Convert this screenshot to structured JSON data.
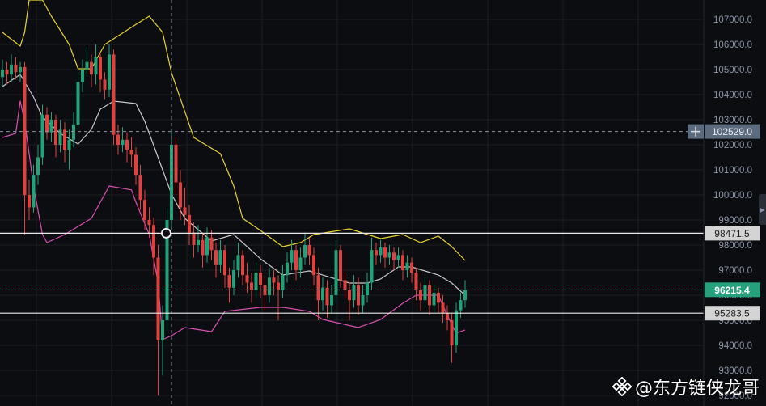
{
  "chart_data": {
    "type": "candlestick",
    "title": "",
    "ylim": [
      92000,
      107000
    ],
    "yticks": [
      "107000.0",
      "106000.0",
      "105000.0",
      "104000.0",
      "103000.0",
      "102000.0",
      "101000.0",
      "100000.0",
      "99000.0",
      "98000.0",
      "97000.0",
      "96000.0",
      "95000.0",
      "94000.0",
      "93000.0",
      "92000.0"
    ],
    "ytick_values": [
      107000,
      106000,
      105000,
      104000,
      103000,
      102000,
      101000,
      100000,
      99000,
      98000,
      97000,
      96000,
      95000,
      94000,
      93000,
      92000
    ],
    "grid": true,
    "colors": {
      "up": "#1fa47a",
      "down": "#e0413f",
      "upper_band": "#e6d12a",
      "middle_band": "#c8c8c8",
      "lower_band": "#d94fb0",
      "last_price": "#26a17b",
      "crosshair_tag": "#5d6b7e"
    },
    "ohlc": [
      [
        104700,
        105400,
        104300,
        105000
      ],
      [
        105000,
        105300,
        104400,
        104800
      ],
      [
        104800,
        105600,
        104500,
        105200
      ],
      [
        105200,
        105500,
        104600,
        104900
      ],
      [
        104900,
        105300,
        104500,
        105100
      ],
      [
        105100,
        105300,
        98400,
        100000
      ],
      [
        100000,
        100600,
        99000,
        99500
      ],
      [
        99500,
        101200,
        99300,
        100800
      ],
      [
        100800,
        102000,
        100400,
        101500
      ],
      [
        101500,
        103600,
        101200,
        103200
      ],
      [
        103200,
        103500,
        102200,
        102500
      ],
      [
        102500,
        103300,
        102100,
        103000
      ],
      [
        103000,
        103200,
        101500,
        102000
      ],
      [
        102000,
        103000,
        101700,
        102600
      ],
      [
        102600,
        102900,
        101300,
        101800
      ],
      [
        101800,
        102600,
        101000,
        102200
      ],
      [
        102200,
        103300,
        101900,
        102800
      ],
      [
        102800,
        104900,
        102600,
        104500
      ],
      [
        104500,
        105400,
        104100,
        105000
      ],
      [
        105000,
        105900,
        104700,
        105300
      ],
      [
        105300,
        105600,
        104300,
        104800
      ],
      [
        104800,
        106000,
        104400,
        105500
      ],
      [
        105500,
        105700,
        104100,
        104600
      ],
      [
        104600,
        104900,
        103800,
        104200
      ],
      [
        104200,
        106000,
        103900,
        105600
      ],
      [
        105600,
        105800,
        102000,
        102400
      ],
      [
        102400,
        102800,
        101600,
        102000
      ],
      [
        102000,
        102700,
        101700,
        102200
      ],
      [
        102200,
        102500,
        101300,
        101800
      ],
      [
        101800,
        102300,
        101100,
        101600
      ],
      [
        101600,
        101900,
        100400,
        100800
      ],
      [
        100800,
        101200,
        99400,
        99800
      ],
      [
        99800,
        100200,
        98600,
        99000
      ],
      [
        99000,
        99500,
        98300,
        98800
      ],
      [
        98800,
        99100,
        96800,
        97500
      ],
      [
        97500,
        98000,
        92000,
        94200
      ],
      [
        94200,
        95600,
        92800,
        95000
      ],
      [
        95000,
        99500,
        94600,
        99000
      ],
      [
        99000,
        102500,
        98700,
        102000
      ],
      [
        102000,
        102300,
        100000,
        100500
      ],
      [
        100500,
        101000,
        99000,
        99500
      ],
      [
        99500,
        100300,
        98800,
        99200
      ],
      [
        99200,
        99600,
        98000,
        98500
      ],
      [
        98500,
        98900,
        97500,
        98000
      ],
      [
        98000,
        98800,
        97700,
        98200
      ],
      [
        98200,
        98500,
        97100,
        97600
      ],
      [
        97600,
        98700,
        97300,
        98300
      ],
      [
        98300,
        98600,
        97400,
        97800
      ],
      [
        97800,
        98100,
        96700,
        97200
      ],
      [
        97200,
        98200,
        96900,
        97800
      ],
      [
        97800,
        98000,
        96300,
        96800
      ],
      [
        96800,
        97100,
        95700,
        96300
      ],
      [
        96300,
        97400,
        96000,
        97000
      ],
      [
        97000,
        98100,
        96700,
        97600
      ],
      [
        97600,
        97800,
        96400,
        96800
      ],
      [
        96800,
        97300,
        96100,
        96500
      ],
      [
        96500,
        96900,
        95700,
        96200
      ],
      [
        96200,
        97300,
        95900,
        96900
      ],
      [
        96900,
        97200,
        95900,
        96400
      ],
      [
        96400,
        96700,
        95400,
        96000
      ],
      [
        96000,
        97100,
        95700,
        96700
      ],
      [
        96700,
        97000,
        96000,
        96500
      ],
      [
        96500,
        96800,
        95000,
        96200
      ],
      [
        96200,
        97200,
        95900,
        96800
      ],
      [
        96800,
        97700,
        96500,
        97300
      ],
      [
        97300,
        98200,
        97000,
        97800
      ],
      [
        97800,
        98000,
        96600,
        97000
      ],
      [
        97000,
        97900,
        96700,
        97500
      ],
      [
        97500,
        98500,
        97200,
        98000
      ],
      [
        98000,
        98300,
        97200,
        97600
      ],
      [
        97600,
        97900,
        96400,
        96800
      ],
      [
        96800,
        97100,
        95000,
        95800
      ],
      [
        95800,
        96700,
        95400,
        96300
      ],
      [
        96300,
        96600,
        95100,
        95600
      ],
      [
        95600,
        96400,
        95300,
        96000
      ],
      [
        96000,
        98200,
        95700,
        97800
      ],
      [
        97800,
        98000,
        96300,
        96600
      ],
      [
        96600,
        96900,
        95900,
        96200
      ],
      [
        96200,
        96500,
        95000,
        95800
      ],
      [
        95800,
        96800,
        95500,
        96400
      ],
      [
        96400,
        96700,
        95200,
        95600
      ],
      [
        95600,
        96400,
        95300,
        96000
      ],
      [
        96000,
        96900,
        95700,
        96500
      ],
      [
        96500,
        98300,
        96200,
        97800
      ],
      [
        97800,
        98100,
        97200,
        97600
      ],
      [
        97600,
        98200,
        97300,
        97900
      ],
      [
        97900,
        98100,
        97100,
        97500
      ],
      [
        97500,
        98000,
        97200,
        97700
      ],
      [
        97700,
        97900,
        97000,
        97400
      ],
      [
        97400,
        97900,
        97100,
        97600
      ],
      [
        97600,
        97800,
        96600,
        97000
      ],
      [
        97000,
        97600,
        96700,
        97300
      ],
      [
        97300,
        97500,
        96500,
        96900
      ],
      [
        96900,
        97100,
        95800,
        96200
      ],
      [
        96200,
        96500,
        95400,
        95800
      ],
      [
        95800,
        96700,
        95500,
        96400
      ],
      [
        96400,
        96600,
        95200,
        95600
      ],
      [
        95600,
        96400,
        95300,
        96100
      ],
      [
        96100,
        96300,
        95300,
        95700
      ],
      [
        95700,
        96000,
        94900,
        95300
      ],
      [
        95300,
        95600,
        94600,
        95000
      ],
      [
        95000,
        95300,
        93300,
        94000
      ],
      [
        94000,
        95700,
        93700,
        95400
      ],
      [
        95400,
        96100,
        95100,
        95800
      ],
      [
        95800,
        96600,
        95500,
        96215.4
      ]
    ],
    "bands": {
      "upper": [
        [
          0,
          106484
        ],
        [
          4,
          105935
        ],
        [
          5,
          106484
        ],
        [
          6,
          107774
        ],
        [
          9,
          107774
        ],
        [
          11,
          107129
        ],
        [
          15,
          106000
        ],
        [
          17,
          105032
        ],
        [
          20,
          105032
        ],
        [
          23,
          106000
        ],
        [
          30,
          106800
        ],
        [
          33,
          107129
        ],
        [
          36,
          106484
        ],
        [
          38,
          104871
        ],
        [
          43,
          102290
        ],
        [
          49,
          101645
        ],
        [
          52,
          100355
        ],
        [
          54,
          99064
        ],
        [
          58,
          98581
        ],
        [
          63,
          97935
        ],
        [
          67,
          98097
        ],
        [
          70,
          98419
        ],
        [
          78,
          98645
        ],
        [
          85,
          98258
        ],
        [
          90,
          98419
        ],
        [
          94,
          98097
        ],
        [
          98,
          98355
        ],
        [
          101,
          97935
        ],
        [
          104,
          97387
        ]
      ],
      "middle": [
        [
          0,
          104323
        ],
        [
          4,
          104806
        ],
        [
          7,
          103903
        ],
        [
          9,
          103097
        ],
        [
          13,
          102452
        ],
        [
          17,
          102032
        ],
        [
          20,
          102613
        ],
        [
          22,
          103419
        ],
        [
          25,
          103742
        ],
        [
          30,
          103645
        ],
        [
          32,
          102935
        ],
        [
          35,
          101484
        ],
        [
          38,
          100032
        ],
        [
          41,
          99064
        ],
        [
          47,
          98161
        ],
        [
          52,
          98419
        ],
        [
          58,
          97452
        ],
        [
          63,
          96806
        ],
        [
          69,
          96968
        ],
        [
          72,
          96806
        ],
        [
          78,
          96484
        ],
        [
          82,
          96484
        ],
        [
          85,
          96645
        ],
        [
          89,
          97129
        ],
        [
          92,
          97129
        ],
        [
          98,
          96806
        ],
        [
          101,
          96484
        ],
        [
          104,
          96000
        ]
      ],
      "lower": [
        [
          0,
          102290
        ],
        [
          3,
          102452
        ],
        [
          4,
          103742
        ],
        [
          5,
          102935
        ],
        [
          7,
          100355
        ],
        [
          9,
          98419
        ],
        [
          10,
          98097
        ],
        [
          14,
          98419
        ],
        [
          17,
          98742
        ],
        [
          20,
          99064
        ],
        [
          24,
          100355
        ],
        [
          29,
          100200
        ],
        [
          30,
          99710
        ],
        [
          33,
          98419
        ],
        [
          35,
          96484
        ],
        [
          36,
          94226
        ],
        [
          38,
          94387
        ],
        [
          41,
          94710
        ],
        [
          47,
          94548
        ],
        [
          50,
          95355
        ],
        [
          58,
          95516
        ],
        [
          63,
          95516
        ],
        [
          69,
          95355
        ],
        [
          72,
          95032
        ],
        [
          80,
          94710
        ],
        [
          85,
          95032
        ],
        [
          90,
          95677
        ],
        [
          93,
          96000
        ],
        [
          98,
          96000
        ],
        [
          100,
          95194
        ],
        [
          102,
          94484
        ],
        [
          104,
          94613
        ]
      ]
    },
    "price_lines": {
      "crosshair_price": "102529.0",
      "crosshair_value": 102529.0,
      "resistance": "98471.5",
      "resistance_value": 98471.5,
      "last_price": "96215.4",
      "last_value": 96215.4,
      "support": "95283.5",
      "support_value": 95283.5
    },
    "crosshair_candle_index": 38,
    "marker_candle_index": 37
  },
  "watermark": {
    "text": "@东方链侠龙哥"
  }
}
